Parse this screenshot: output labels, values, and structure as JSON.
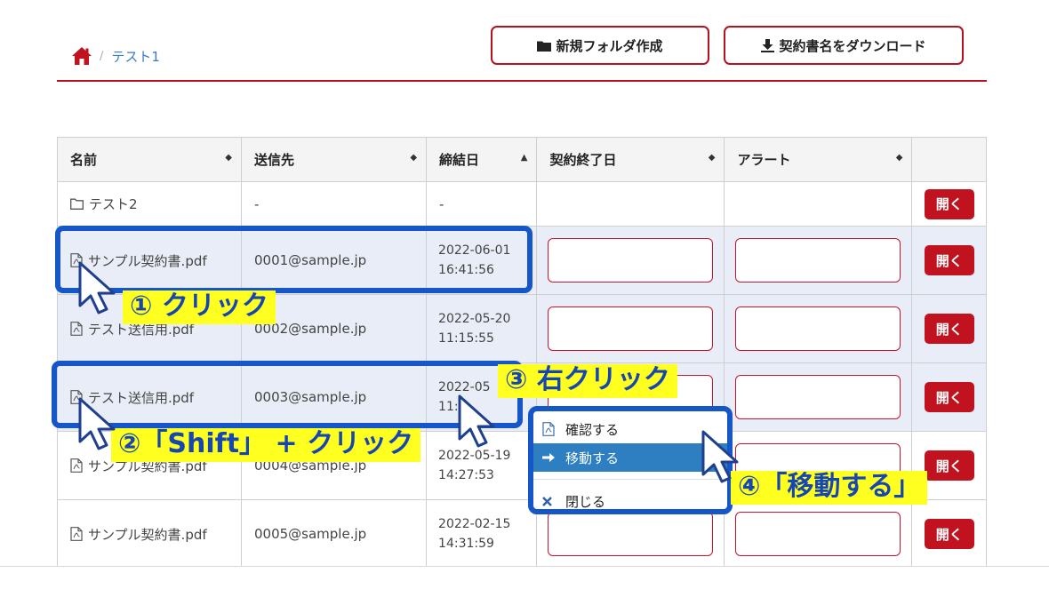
{
  "breadcrumb": {
    "current": "テスト1",
    "separator": "/"
  },
  "toolbar": {
    "new_folder_label": "新規フォルダ作成",
    "download_label": "契約書名をダウンロード"
  },
  "table": {
    "headers": [
      "名前",
      "送信先",
      "締結日",
      "契約終了日",
      "アラート"
    ],
    "sort_icons": [
      "◆",
      "◆",
      "▲",
      "◆",
      "◆"
    ],
    "open_label": "開く",
    "rows": [
      {
        "name": "テスト2",
        "dest": "-",
        "date": "-",
        "time": ""
      },
      {
        "name": "サンプル契約書.pdf",
        "dest": "0001@sample.jp",
        "date": "2022-06-01",
        "time": "16:41:56"
      },
      {
        "name": "テスト送信用.pdf",
        "dest": "0002@sample.jp",
        "date": "2022-05-20",
        "time": "11:15:55"
      },
      {
        "name": "テスト送信用.pdf",
        "dest": "0003@sample.jp",
        "date": "2022-05",
        "time": "11:1"
      },
      {
        "name": "サンプル契約書.pdf",
        "dest": "0004@sample.jp",
        "date": "2022-05-19",
        "time": "14:27:53"
      },
      {
        "name": "サンプル契約書.pdf",
        "dest": "0005@sample.jp",
        "date": "2022-02-15",
        "time": "14:31:59"
      }
    ]
  },
  "context_menu": {
    "items": [
      "確認する",
      "移動する",
      "閉じる"
    ],
    "active_index": 1
  },
  "annotations": {
    "step1": "① クリック",
    "step2": "②「Shift」 + クリック",
    "step3": "③ 右クリック",
    "step4": "④「移動する」"
  },
  "colors": {
    "brand_red": "#c1121f",
    "highlight_blue": "#1556c9",
    "label_yellow": "#ffff20",
    "menu_active": "#2d7fc2"
  }
}
